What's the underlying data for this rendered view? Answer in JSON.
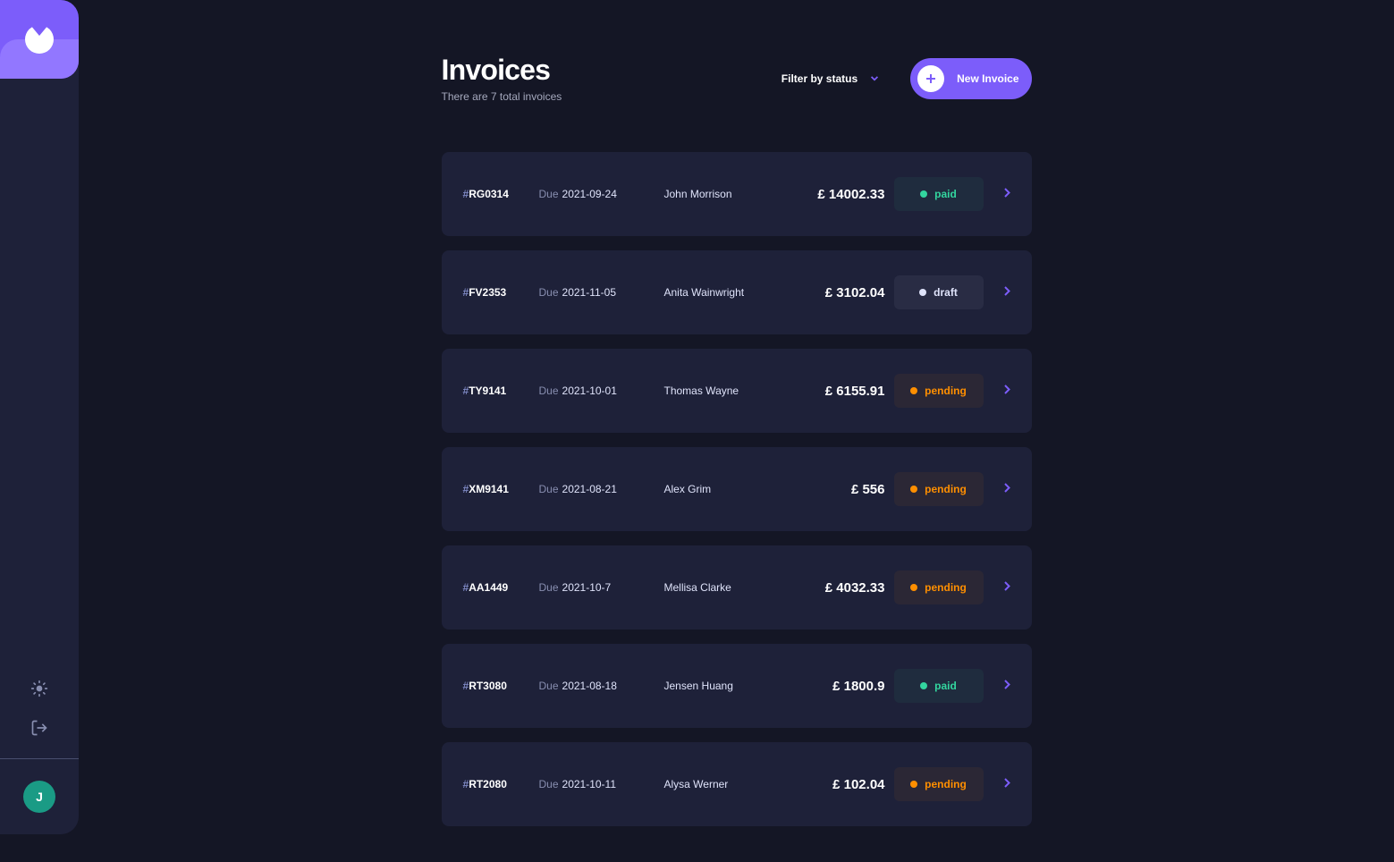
{
  "header": {
    "title": "Invoices",
    "count_text": "There are 7 total invoices",
    "filter_label": "Filter by status",
    "new_invoice_label": "New Invoice"
  },
  "avatar": {
    "initial": "J"
  },
  "colors": {
    "accent": "#7c5dfa",
    "background": "#141625",
    "card": "#1e2139",
    "paid": "#33d69f",
    "pending": "#ff8f00",
    "draft": "#dfe3fa"
  },
  "invoices": [
    {
      "id": "RG0314",
      "due_date": "2021-09-24",
      "client": "John Morrison",
      "amount": "£ 14002.33",
      "status": "paid"
    },
    {
      "id": "FV2353",
      "due_date": "2021-11-05",
      "client": "Anita Wainwright",
      "amount": "£ 3102.04",
      "status": "draft"
    },
    {
      "id": "TY9141",
      "due_date": "2021-10-01",
      "client": "Thomas Wayne",
      "amount": "£ 6155.91",
      "status": "pending"
    },
    {
      "id": "XM9141",
      "due_date": "2021-08-21",
      "client": "Alex Grim",
      "amount": "£ 556",
      "status": "pending"
    },
    {
      "id": "AA1449",
      "due_date": "2021-10-7",
      "client": "Mellisa Clarke",
      "amount": "£ 4032.33",
      "status": "pending"
    },
    {
      "id": "RT3080",
      "due_date": "2021-08-18",
      "client": "Jensen Huang",
      "amount": "£ 1800.9",
      "status": "paid"
    },
    {
      "id": "RT2080",
      "due_date": "2021-10-11",
      "client": "Alysa Werner",
      "amount": "£ 102.04",
      "status": "pending"
    }
  ],
  "labels": {
    "due": "Due"
  }
}
